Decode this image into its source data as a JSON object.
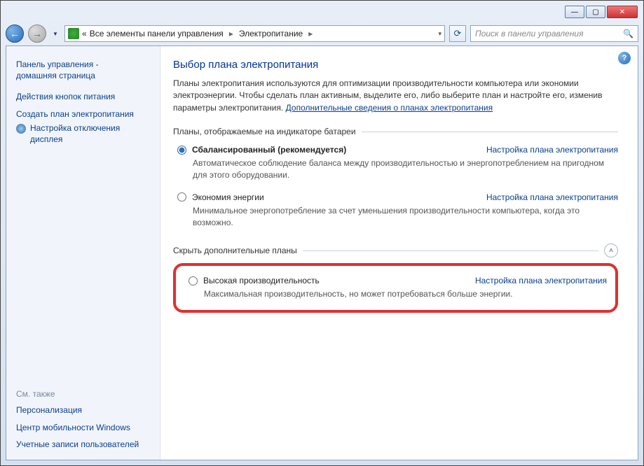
{
  "titlebar": {},
  "nav": {
    "breadcrumb_sep_left": "«",
    "breadcrumb1": "Все элементы панели управления",
    "breadcrumb2": "Электропитание",
    "search_placeholder": "Поиск в панели управления"
  },
  "sidebar": {
    "home_line1": "Панель управления -",
    "home_line2": "домашняя страница",
    "link1": "Действия кнопок питания",
    "link2": "Создать план электропитания",
    "link3": "Настройка отключения дисплея",
    "see_also_hdr": "См. также",
    "see1": "Персонализация",
    "see2": "Центр мобильности Windows",
    "see3": "Учетные записи пользователей"
  },
  "main": {
    "title": "Выбор плана электропитания",
    "intro_text": "Планы электропитания используются для оптимизации производительности компьютера или экономии электроэнергии. Чтобы сделать план активным, выделите его, либо выберите план и настройте его, изменив параметры электропитания. ",
    "intro_link": "Дополнительные сведения о планах электропитания",
    "group1_hdr": "Планы, отображаемые на индикаторе батареи",
    "settings_link": "Настройка плана электропитания",
    "plan1_name": "Сбалансированный (рекомендуется)",
    "plan1_desc": "Автоматическое соблюдение баланса между производительностью и энергопотреблением на пригодном для этого оборудовании.",
    "plan2_name": "Экономия энергии",
    "plan2_desc": "Минимальное энергопотребление за счет уменьшения производительности компьютера, когда это возможно.",
    "group2_hdr": "Скрыть дополнительные планы",
    "plan3_name": "Высокая производительность",
    "plan3_desc": "Максимальная производительность, но может потребоваться больше энергии."
  }
}
